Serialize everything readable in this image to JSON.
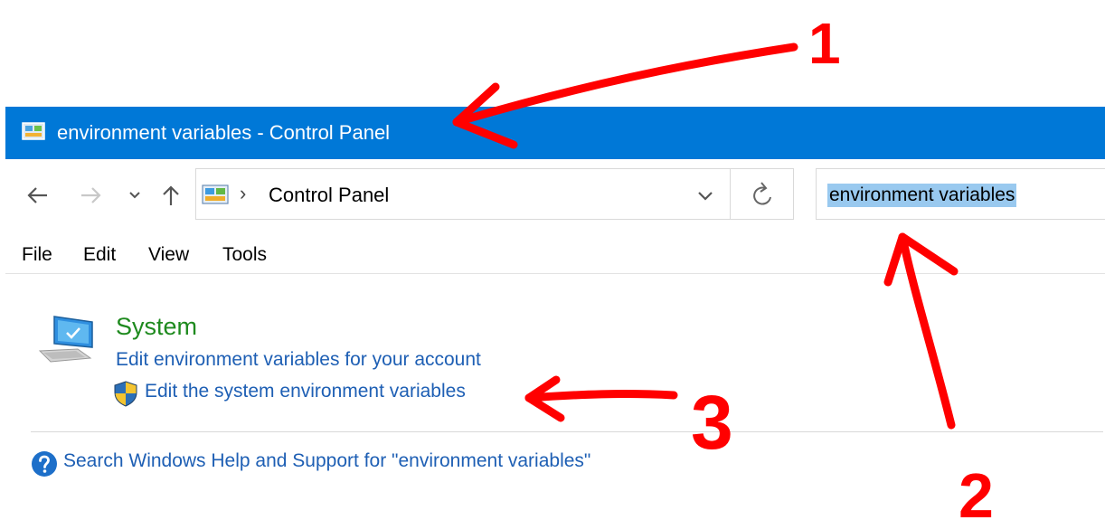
{
  "window": {
    "title": "environment variables - Control Panel"
  },
  "address_bar": {
    "breadcrumb_separator": "›",
    "location": "Control Panel"
  },
  "search": {
    "value": "environment variables"
  },
  "menu": {
    "items": [
      "File",
      "Edit",
      "View",
      "Tools"
    ]
  },
  "results": {
    "group_title": "System",
    "links": [
      "Edit environment variables for your account",
      "Edit the system environment variables"
    ],
    "help_link": "Search Windows Help and Support for \"environment variables\""
  },
  "annotations": {
    "labels": [
      "1",
      "2",
      "3"
    ],
    "color": "#ff0000"
  },
  "colors": {
    "titlebar": "#0078d7",
    "link": "#1e5fb4",
    "group_title": "#1e8a1e",
    "selection": "#99c9ef"
  },
  "icons": [
    "control-panel-icon",
    "back-arrow-icon",
    "forward-arrow-icon",
    "recent-locations-chevron-icon",
    "up-arrow-icon",
    "chevron-down-icon",
    "refresh-icon",
    "computer-monitor-icon",
    "uac-shield-icon",
    "help-question-icon"
  ]
}
